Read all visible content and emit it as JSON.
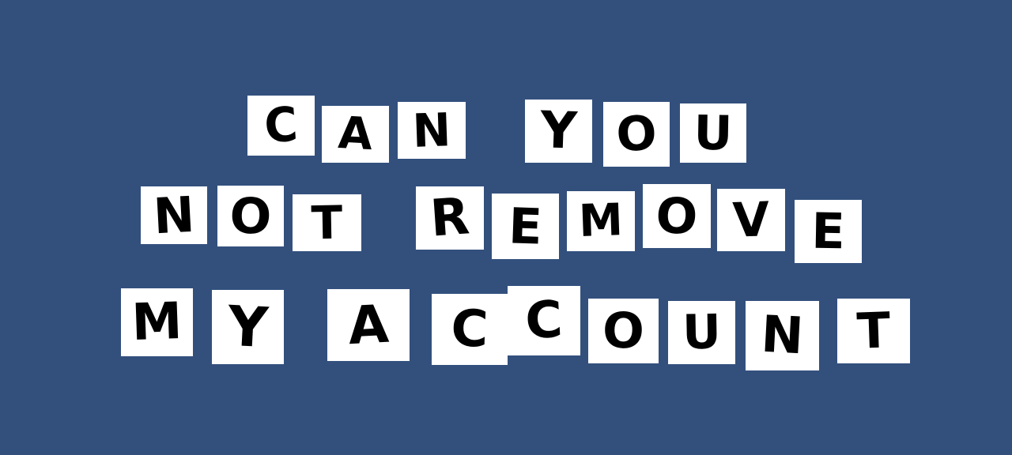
{
  "background_color": "#33507d",
  "tile_color": "#ffffff",
  "ink_color": "#000000",
  "lines": [
    {
      "text": "CAN YOU",
      "letters": [
        "C",
        "A",
        "N",
        "Y",
        "O",
        "U"
      ]
    },
    {
      "text": "NOT REMOVE",
      "letters": [
        "N",
        "O",
        "T",
        "R",
        "E",
        "M",
        "O",
        "V",
        "E"
      ]
    },
    {
      "text": "MY ACCOUNT",
      "letters": [
        "M",
        "Y",
        "A",
        "C",
        "C",
        "O",
        "U",
        "N",
        "T"
      ]
    }
  ]
}
